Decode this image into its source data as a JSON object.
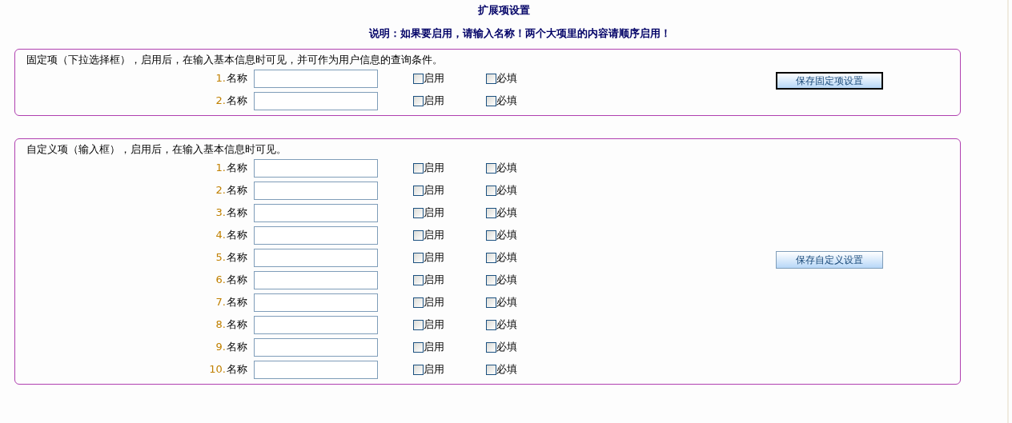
{
  "title": "扩展项设置",
  "notice": "说明：如果要启用，请输入名称！两个大项里的内容请顺序启用！",
  "sections": [
    {
      "description": "固定项（下拉选择框），启用后，在输入基本信息时可见，并可作为用户信息的查询条件。",
      "button": {
        "label": "保存固定项设置",
        "focused": true
      },
      "rows": [
        {
          "number": "1.",
          "label": "名称",
          "enable_label": "启用",
          "enabled": false,
          "required_label": "必填",
          "required": false
        },
        {
          "number": "2.",
          "label": "名称",
          "enable_label": "启用",
          "enabled": false,
          "required_label": "必填",
          "required": false
        }
      ]
    },
    {
      "description": "自定义项（输入框），启用后，在输入基本信息时可见。",
      "button": {
        "label": "保存自定义设置",
        "focused": false
      },
      "rows": [
        {
          "number": "1.",
          "label": "名称",
          "enable_label": "启用",
          "enabled": false,
          "required_label": "必填",
          "required": false
        },
        {
          "number": "2.",
          "label": "名称",
          "enable_label": "启用",
          "enabled": false,
          "required_label": "必填",
          "required": false
        },
        {
          "number": "3.",
          "label": "名称",
          "enable_label": "启用",
          "enabled": false,
          "required_label": "必填",
          "required": false
        },
        {
          "number": "4.",
          "label": "名称",
          "enable_label": "启用",
          "enabled": false,
          "required_label": "必填",
          "required": false
        },
        {
          "number": "5.",
          "label": "名称",
          "enable_label": "启用",
          "enabled": false,
          "required_label": "必填",
          "required": false
        },
        {
          "number": "6.",
          "label": "名称",
          "enable_label": "启用",
          "enabled": false,
          "required_label": "必填",
          "required": false
        },
        {
          "number": "7.",
          "label": "名称",
          "enable_label": "启用",
          "enabled": false,
          "required_label": "必填",
          "required": false
        },
        {
          "number": "8.",
          "label": "名称",
          "enable_label": "启用",
          "enabled": false,
          "required_label": "必填",
          "required": false
        },
        {
          "number": "9.",
          "label": "名称",
          "enable_label": "启用",
          "enabled": false,
          "required_label": "必填",
          "required": false
        },
        {
          "number": "10.",
          "label": "名称",
          "enable_label": "启用",
          "enabled": false,
          "required_label": "必填",
          "required": false
        }
      ]
    }
  ]
}
